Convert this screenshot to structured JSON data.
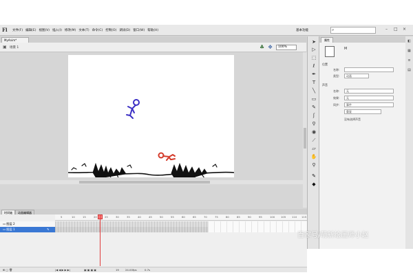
{
  "app": {
    "logo": "Fl"
  },
  "menu": {
    "items": [
      "文件(F)",
      "编辑(E)",
      "视图(V)",
      "插入(I)",
      "修改(M)",
      "文本(T)",
      "命令(C)",
      "控制(O)",
      "调试(D)",
      "窗口(W)",
      "帮助(H)"
    ],
    "workspace": "基本功能"
  },
  "document": {
    "tab": "MyAnim*",
    "scene": "场景 1",
    "zoom": "100%"
  },
  "timeline": {
    "tabs": [
      "时间轴",
      "动画编辑器"
    ],
    "ruler": [
      "5",
      "10",
      "15",
      "20",
      "25",
      "30",
      "35",
      "40",
      "45",
      "50",
      "55",
      "60",
      "65",
      "70",
      "75",
      "80",
      "85",
      "90",
      "95",
      "100",
      "105",
      "110",
      "115"
    ],
    "layers": [
      "图层 2",
      "图层 1"
    ],
    "status": {
      "frame": "19",
      "fps": "24.00fps",
      "time": "0.7s"
    }
  },
  "properties": {
    "tab": "属性",
    "symbol_label": "M",
    "sections": [
      "位置",
      "声音"
    ],
    "rows": [
      {
        "label": "名称:",
        "value": ""
      },
      {
        "label": "类型:",
        "value": "动画"
      },
      {
        "label": "名称:",
        "value": "无"
      },
      {
        "label": "效果:",
        "value": "无"
      },
      {
        "label": "同步:",
        "value": "事件"
      },
      {
        "label": "",
        "value": "重复"
      }
    ],
    "note": "没有选择声音"
  },
  "watermark": "百家号/萌新绘画师小赵",
  "colors": {
    "stick_figure_blue": "#3b2fc4",
    "stick_figure_red": "#d43a2a",
    "grass": "#111111",
    "playhead": "#e03a3a",
    "selected_layer": "#3a78d4"
  },
  "icons": [
    "search-icon",
    "minimize-icon",
    "restore-icon",
    "close-icon",
    "arrow-tool-icon",
    "subselect-tool-icon",
    "free-transform-icon",
    "lasso-icon",
    "pen-tool-icon",
    "text-tool-icon",
    "line-tool-icon",
    "rectangle-tool-icon",
    "pencil-tool-icon",
    "brush-tool-icon",
    "bone-tool-icon",
    "paint-bucket-icon",
    "eyedropper-icon",
    "eraser-icon",
    "hand-tool-icon",
    "zoom-tool-icon"
  ]
}
